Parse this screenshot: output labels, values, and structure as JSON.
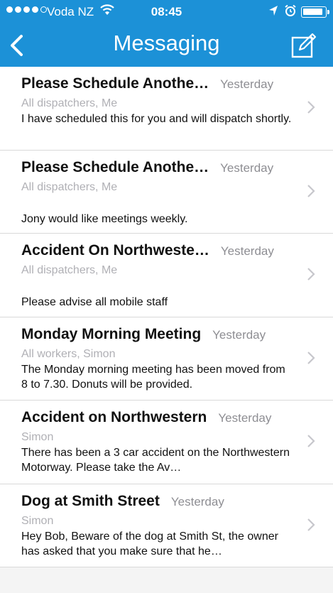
{
  "status_bar": {
    "carrier": "Voda NZ",
    "time": "08:45"
  },
  "nav": {
    "title": "Messaging",
    "back_icon": "chevron-left-icon",
    "compose_icon": "compose-icon"
  },
  "messages": [
    {
      "subject": "Please Schedule Anothe…",
      "date": "Yesterday",
      "recipients": "All dispatchers, Me",
      "preview": "I have scheduled this for you and will dispatch shortly."
    },
    {
      "subject": "Please Schedule Anothe…",
      "date": "Yesterday",
      "recipients": "All dispatchers, Me",
      "preview": "Jony would like meetings weekly."
    },
    {
      "subject": "Accident On Northweste…",
      "date": "Yesterday",
      "recipients": "All dispatchers, Me",
      "preview": "Please advise all mobile staff"
    },
    {
      "subject": "Monday Morning Meeting",
      "date": "Yesterday",
      "recipients": "All workers, Simon",
      "preview": "The Monday morning meeting has been moved from 8 to 7.30. Donuts will be provided."
    },
    {
      "subject": "Accident on Northwestern",
      "date": "Yesterday",
      "recipients": "Simon",
      "preview": "There has been a 3 car accident on the Northwestern Motorway. Please take the Av…"
    },
    {
      "subject": "Dog at Smith Street",
      "date": "Yesterday",
      "recipients": "Simon",
      "preview": "Hey Bob, Beware of the dog at Smith St, the owner has asked that you make sure that he…"
    }
  ],
  "colors": {
    "accent": "#1c91d7",
    "secondary_text": "#8e8e93",
    "recipient_text": "#b0b0b5"
  }
}
